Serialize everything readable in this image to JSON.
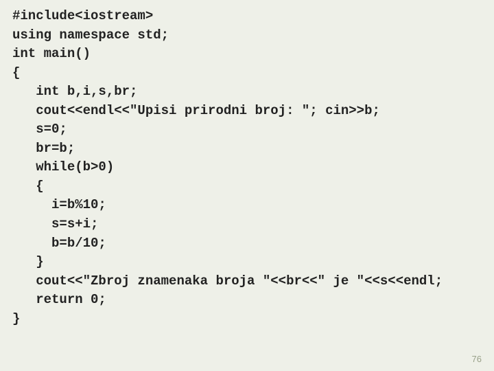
{
  "code": {
    "lines": [
      "#include<iostream>",
      "using namespace std;",
      "int main()",
      "{",
      "   int b,i,s,br;",
      "   cout<<endl<<\"Upisi prirodni broj: \"; cin>>b;",
      "   s=0;",
      "   br=b;",
      "   while(b>0)",
      "   {",
      "     i=b%10;",
      "     s=s+i;",
      "     b=b/10;",
      "   }",
      "   cout<<\"Zbroj znamenaka broja \"<<br<<\" je \"<<s<<endl;",
      "   return 0;",
      "}"
    ]
  },
  "page_number": "76"
}
